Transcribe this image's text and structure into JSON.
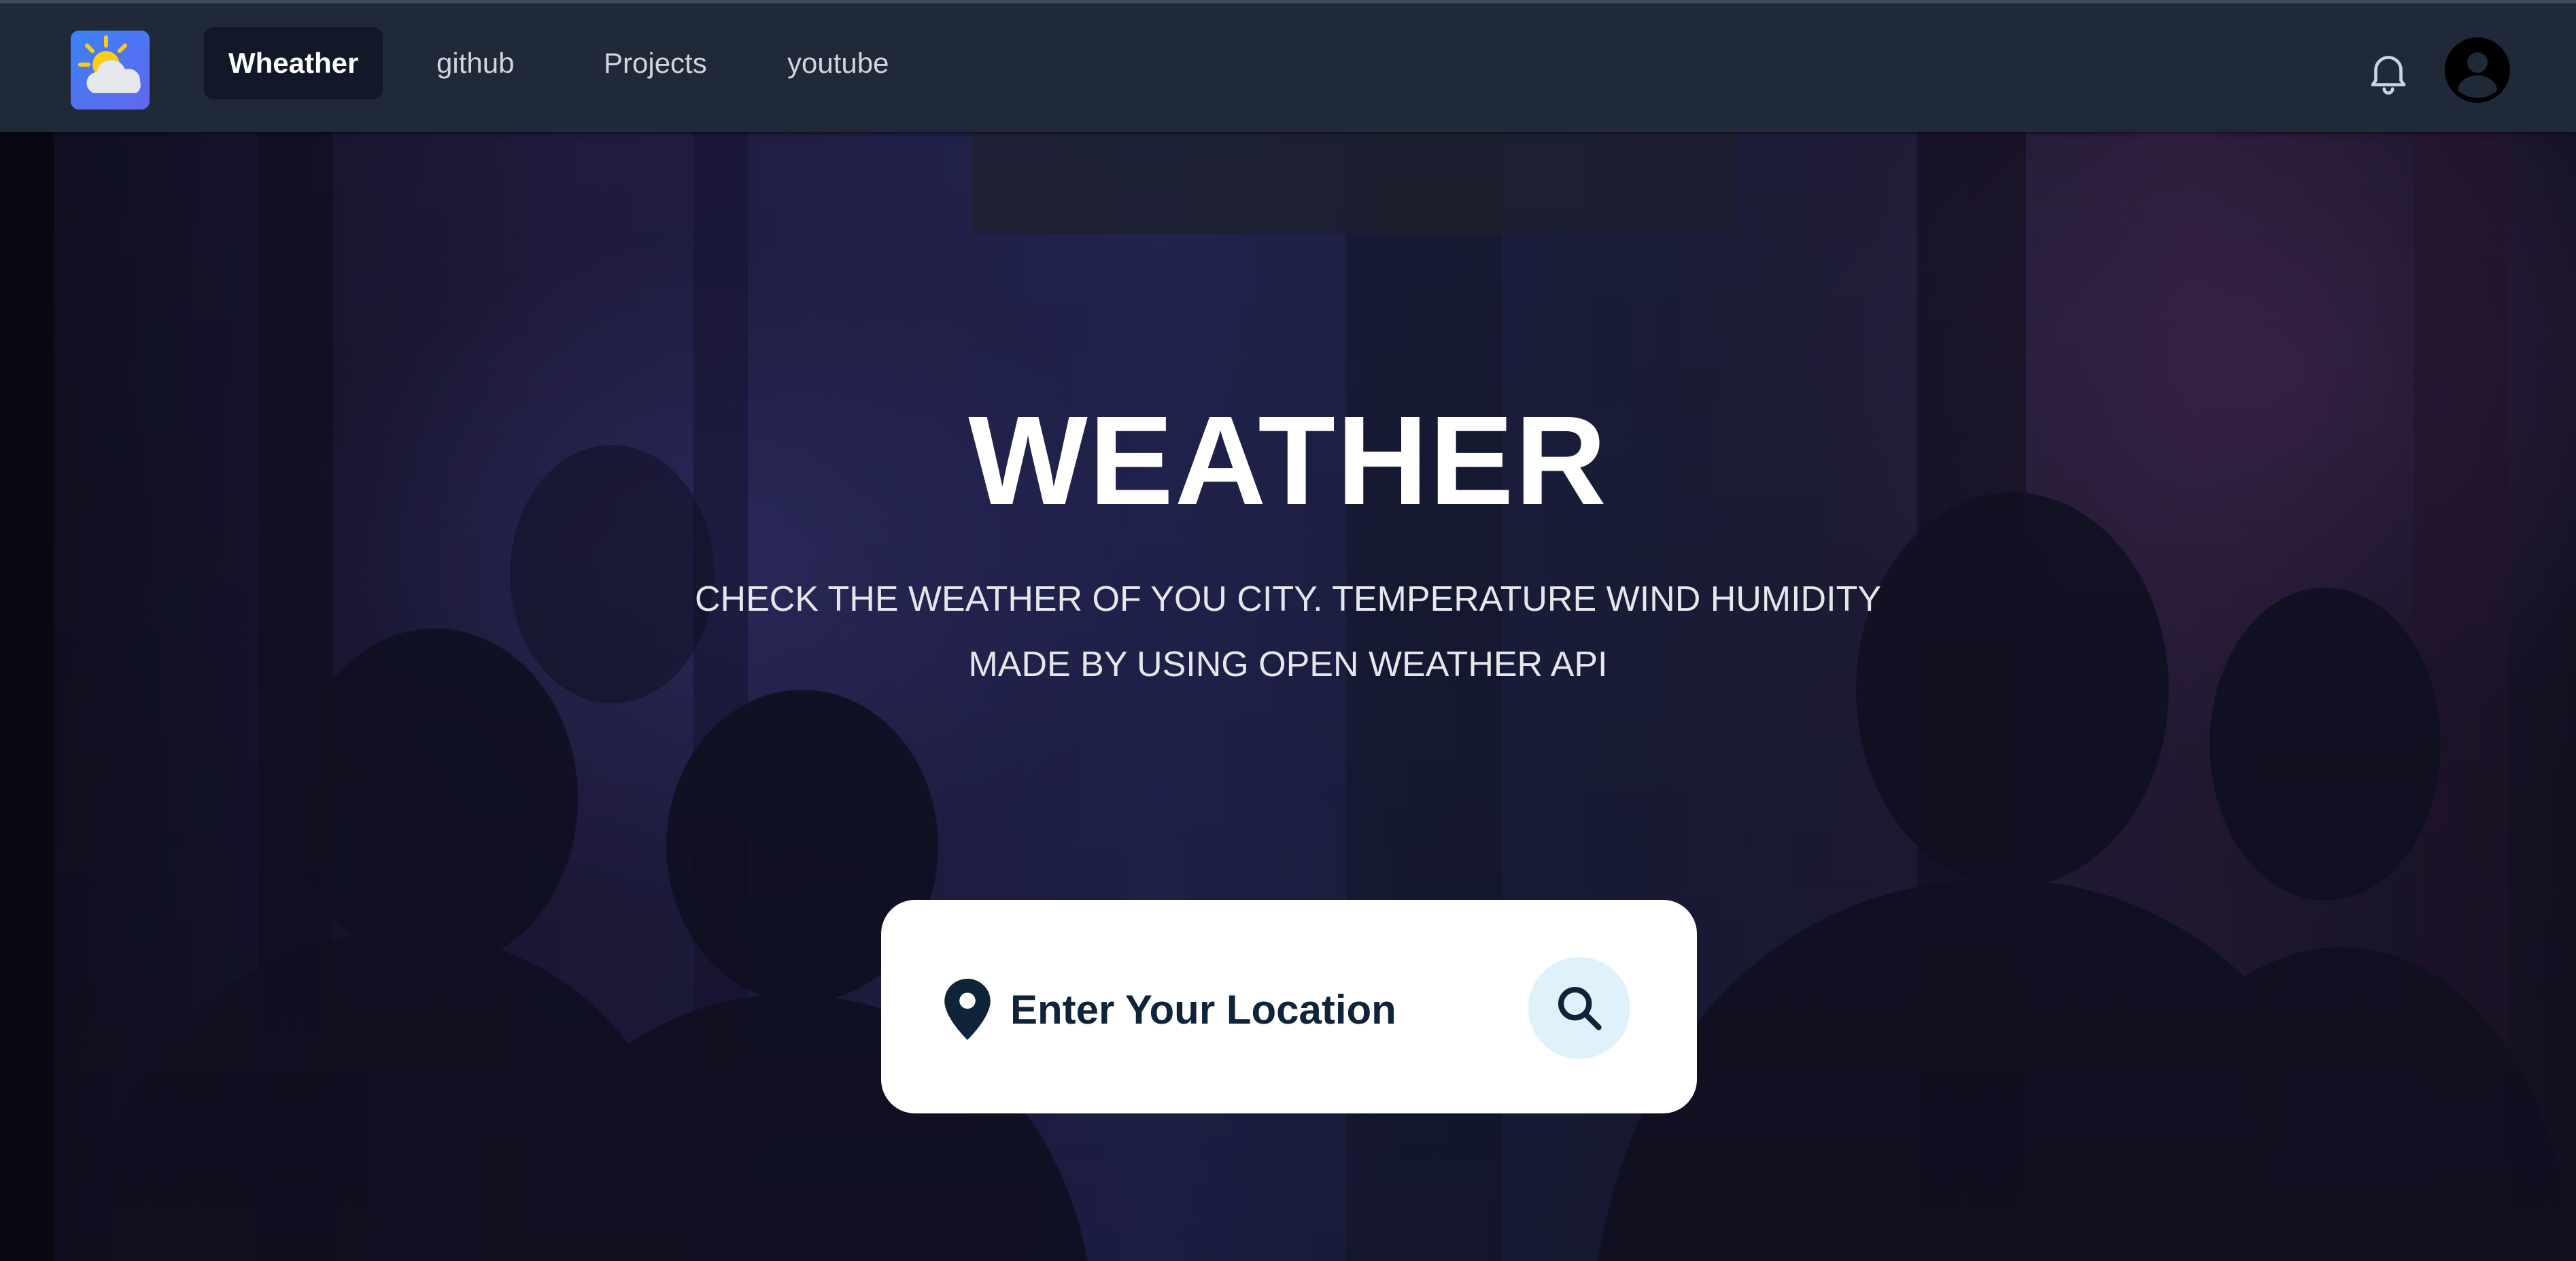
{
  "nav": {
    "logo_icon": "sun-cloud-logo-icon",
    "links": [
      {
        "label": "Wheather",
        "active": true
      },
      {
        "label": "github",
        "active": false
      },
      {
        "label": "Projects",
        "active": false
      },
      {
        "label": "youtube",
        "active": false
      }
    ],
    "notification_icon": "bell-icon",
    "profile_icon": "user-avatar-icon"
  },
  "hero": {
    "title": "WEATHER",
    "subtitle_line1": "CHECK THE WEATHER OF YOU CITY. TEMPERATURE WIND HUMIDITY",
    "subtitle_line2": "MADE BY USING OPEN WEATHER API"
  },
  "search": {
    "placeholder": "Enter Your Location",
    "location_icon": "map-pin-icon",
    "button_icon": "search-icon"
  },
  "colors": {
    "navbar_bg": "#1f2937",
    "active_link_bg": "#111827",
    "search_text": "#0f2438",
    "search_button_bg": "#dff1fb"
  }
}
